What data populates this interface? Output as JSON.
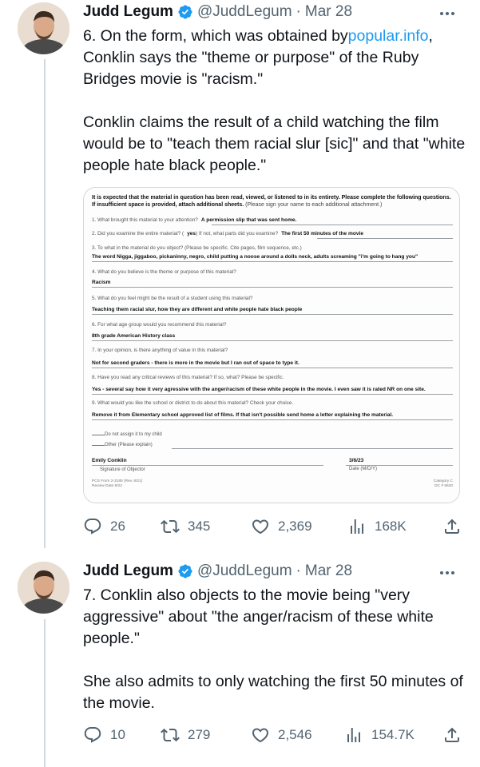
{
  "tweets": [
    {
      "author_name": "Judd Legum",
      "handle": "@JuddLegum",
      "separator": "·",
      "date": "Mar 28",
      "text_p1_before_link": "6. On the form, which was obtained by",
      "text_p1_link": "popular.info",
      "text_p1_after_link": ", Conklin says the \"theme or purpose\" of the Ruby Bridges movie is \"racism.\"",
      "text_p2": "Conklin claims the result of a child watching the film would be to \"teach them racial slur [sic]\" and that \"white people hate black people.\"",
      "replies": "26",
      "reposts": "345",
      "likes": "2,369",
      "views": "168K"
    },
    {
      "author_name": "Judd Legum",
      "handle": "@JuddLegum",
      "separator": "·",
      "date": "Mar 28",
      "text_p1": "7. Conklin also objects to the movie being \"very aggressive\" about \"the anger/racism of these white people.\"",
      "text_p2": "She also admits to only watching the first 50 minutes of the movie.",
      "replies": "10",
      "reposts": "279",
      "likes": "2,546",
      "views": "154.7K"
    }
  ],
  "form": {
    "header_bold": "It is expected that the material in question has been read, viewed, or listened to in its entirety. Please complete the following questions. If insufficient space is provided, attach additional sheets.",
    "header_small": "(Please sign your name to each additional attachment.)",
    "q1": "1. What brought this material to your attention?",
    "a1": "A permission slip that was sent home.",
    "q2a": "2. Did you examine the entire material? (",
    "q2_yes": "yes",
    "q2b": ") If not, what parts did you examine?",
    "a2": "The first 50 minutes of the movie",
    "q3": "3. To what in the material do you object? (Please be specific. Cite pages, film sequence, etc.)",
    "a3": "The word Nigga, jiggaboo, pickaninny, negro, child putting a noose around a dolls neck, adults screaming \"i'm going to hang you\"",
    "q4": "4. What do you believe is the theme or purpose of this material?",
    "a4": "Racism",
    "q5": "5. What do you feel might be the result of a student using this material?",
    "a5": "Teaching them racial slur, how they are different and white people hate black people",
    "q6": "6. For what age group would you recommend this material?",
    "a6": "8th grade American History class",
    "q7": "7. In your opinion, is there anything of value in this material?",
    "a7": "Not for second graders - there is more in the movie but I ran out of space to type it.",
    "q8": "8. Have you read any critical reviews of this material? If so, what? Please be specific.",
    "a8": "Yes - several say how it very agressive with the anger/racism of these white people in the movie. I even saw it is rated NR on one site.",
    "q9": "9. What would you like the school or district to do about this material? Check your choice.",
    "a9": "Remove it from Elementary school approved list of films. If that isn't possible send home a letter explaining the material.",
    "opt1": "Do not assign it to my child",
    "opt2": "Other (Please explain)",
    "signer": "Emily Conklin",
    "signer_label": "Signature of Objector",
    "sign_date": "3/6/23",
    "date_label": "Date (M/D/Y)",
    "footer_left1": "PCS Form 2-3185 (Rev. 8/21)",
    "footer_left2": "Review Date 8/22",
    "footer_right1": "Category C",
    "footer_right2": "DC # 5620"
  },
  "colors": {
    "accent_link": "#1d9bf0",
    "verified_badge": "#1d9bf0",
    "muted_text": "#536471",
    "thread_line": "#cfd9de"
  },
  "icons": [
    "verified-badge-icon",
    "more-icon",
    "reply-icon",
    "repost-icon",
    "like-icon",
    "views-icon",
    "share-icon"
  ]
}
